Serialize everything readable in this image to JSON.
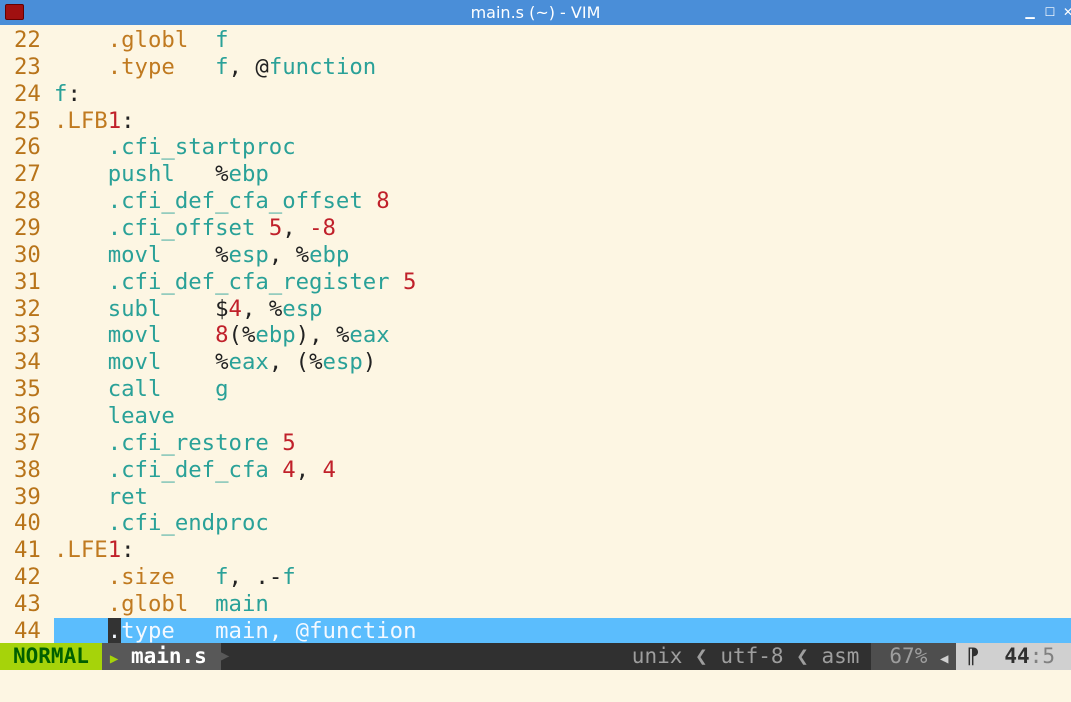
{
  "window": {
    "title": "main.s (~) - VIM",
    "controls": {
      "minimize": "▁",
      "maximize": "☐",
      "close": "✕"
    }
  },
  "editor": {
    "lines": [
      {
        "n": "22",
        "seg": [
          [
            "",
            "    "
          ],
          [
            "dir",
            ".globl"
          ],
          [
            "",
            "  "
          ],
          [
            "id",
            "f"
          ]
        ]
      },
      {
        "n": "23",
        "seg": [
          [
            "",
            "    "
          ],
          [
            "dir",
            ".type"
          ],
          [
            "",
            "   "
          ],
          [
            "id",
            "f"
          ],
          [
            "txt",
            ", @"
          ],
          [
            "id",
            "function"
          ]
        ]
      },
      {
        "n": "24",
        "seg": [
          [
            "id",
            "f"
          ],
          [
            "txt",
            ":"
          ]
        ]
      },
      {
        "n": "25",
        "seg": [
          [
            "dir",
            ".LFB"
          ],
          [
            "num",
            "1"
          ],
          [
            "txt",
            ":"
          ]
        ]
      },
      {
        "n": "26",
        "seg": [
          [
            "",
            "    "
          ],
          [
            "ins",
            ".cfi_startproc"
          ]
        ]
      },
      {
        "n": "27",
        "seg": [
          [
            "",
            "    "
          ],
          [
            "ins",
            "pushl"
          ],
          [
            "",
            "   "
          ],
          [
            "txt",
            "%"
          ],
          [
            "id",
            "ebp"
          ]
        ]
      },
      {
        "n": "28",
        "seg": [
          [
            "",
            "    "
          ],
          [
            "ins",
            ".cfi_def_cfa_offset"
          ],
          [
            "txt",
            " "
          ],
          [
            "num",
            "8"
          ]
        ]
      },
      {
        "n": "29",
        "seg": [
          [
            "",
            "    "
          ],
          [
            "ins",
            ".cfi_offset"
          ],
          [
            "txt",
            " "
          ],
          [
            "num",
            "5"
          ],
          [
            "txt",
            ", "
          ],
          [
            "num",
            "-8"
          ]
        ]
      },
      {
        "n": "30",
        "seg": [
          [
            "",
            "    "
          ],
          [
            "ins",
            "movl"
          ],
          [
            "",
            "    "
          ],
          [
            "txt",
            "%"
          ],
          [
            "id",
            "esp"
          ],
          [
            "txt",
            ", %"
          ],
          [
            "id",
            "ebp"
          ]
        ]
      },
      {
        "n": "31",
        "seg": [
          [
            "",
            "    "
          ],
          [
            "ins",
            ".cfi_def_cfa_register"
          ],
          [
            "txt",
            " "
          ],
          [
            "num",
            "5"
          ]
        ]
      },
      {
        "n": "32",
        "seg": [
          [
            "",
            "    "
          ],
          [
            "ins",
            "subl"
          ],
          [
            "",
            "    "
          ],
          [
            "txt",
            "$"
          ],
          [
            "num",
            "4"
          ],
          [
            "txt",
            ", %"
          ],
          [
            "id",
            "esp"
          ]
        ]
      },
      {
        "n": "33",
        "seg": [
          [
            "",
            "    "
          ],
          [
            "ins",
            "movl"
          ],
          [
            "",
            "    "
          ],
          [
            "num",
            "8"
          ],
          [
            "txt",
            "(%"
          ],
          [
            "id",
            "ebp"
          ],
          [
            "txt",
            "), %"
          ],
          [
            "id",
            "eax"
          ]
        ]
      },
      {
        "n": "34",
        "seg": [
          [
            "",
            "    "
          ],
          [
            "ins",
            "movl"
          ],
          [
            "",
            "    "
          ],
          [
            "txt",
            "%"
          ],
          [
            "id",
            "eax"
          ],
          [
            "txt",
            ", (%"
          ],
          [
            "id",
            "esp"
          ],
          [
            "txt",
            ")"
          ]
        ]
      },
      {
        "n": "35",
        "seg": [
          [
            "",
            "    "
          ],
          [
            "ins",
            "call"
          ],
          [
            "",
            "    "
          ],
          [
            "id",
            "g"
          ]
        ]
      },
      {
        "n": "36",
        "seg": [
          [
            "",
            "    "
          ],
          [
            "ins",
            "leave"
          ]
        ]
      },
      {
        "n": "37",
        "seg": [
          [
            "",
            "    "
          ],
          [
            "ins",
            ".cfi_restore"
          ],
          [
            "txt",
            " "
          ],
          [
            "num",
            "5"
          ]
        ]
      },
      {
        "n": "38",
        "seg": [
          [
            "",
            "    "
          ],
          [
            "ins",
            ".cfi_def_cfa"
          ],
          [
            "txt",
            " "
          ],
          [
            "num",
            "4"
          ],
          [
            "txt",
            ", "
          ],
          [
            "num",
            "4"
          ]
        ]
      },
      {
        "n": "39",
        "seg": [
          [
            "",
            "    "
          ],
          [
            "ins",
            "ret"
          ]
        ]
      },
      {
        "n": "40",
        "seg": [
          [
            "",
            "    "
          ],
          [
            "ins",
            ".cfi_endproc"
          ]
        ]
      },
      {
        "n": "41",
        "seg": [
          [
            "dir",
            ".LFE"
          ],
          [
            "num",
            "1"
          ],
          [
            "txt",
            ":"
          ]
        ]
      },
      {
        "n": "42",
        "seg": [
          [
            "",
            "    "
          ],
          [
            "dir",
            ".size"
          ],
          [
            "",
            "   "
          ],
          [
            "id",
            "f"
          ],
          [
            "txt",
            ", .-"
          ],
          [
            "id",
            "f"
          ]
        ]
      },
      {
        "n": "43",
        "seg": [
          [
            "",
            "    "
          ],
          [
            "dir",
            ".globl"
          ],
          [
            "",
            "  "
          ],
          [
            "id",
            "main"
          ]
        ]
      },
      {
        "n": "44",
        "current": true,
        "seg": [
          [
            "",
            "    "
          ],
          [
            "cursor",
            "."
          ],
          [
            "dir",
            "type"
          ],
          [
            "",
            "   "
          ],
          [
            "id",
            "main"
          ],
          [
            "txt",
            ", @"
          ],
          [
            "id",
            "function"
          ]
        ]
      }
    ]
  },
  "statusline": {
    "mode": "NORMAL",
    "file": "main.s",
    "fileformat": "unix",
    "encoding": "utf-8",
    "filetype": "asm",
    "percent": "67%",
    "line": "44",
    "col": "5",
    "colors": {
      "mode_bg": "#a6d30a",
      "highlight": "#5bbdfd",
      "background": "#fdf6e3",
      "titlebar": "#4a8ed8"
    }
  }
}
